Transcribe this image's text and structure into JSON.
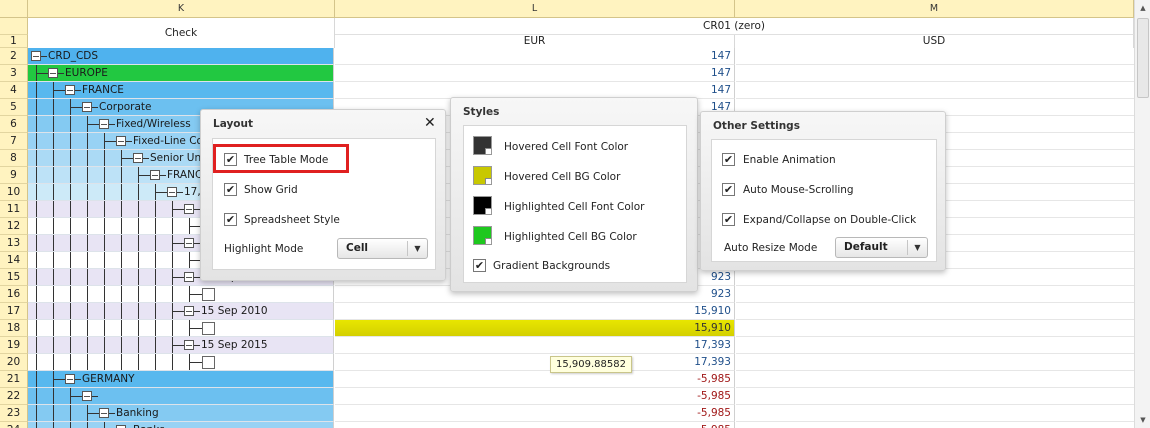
{
  "columns": {
    "k": "K",
    "l": "L",
    "m": "M",
    "check": "Check",
    "group": "CR01 (zero)",
    "eur": "EUR",
    "usd": "USD"
  },
  "rows": [
    {
      "n": "2",
      "label": "CRD_CDS",
      "val": "147"
    },
    {
      "n": "3",
      "label": "EUROPE",
      "val": "147"
    },
    {
      "n": "4",
      "label": "FRANCE",
      "val": "147"
    },
    {
      "n": "5",
      "label": "Corporate",
      "val": "147"
    },
    {
      "n": "6",
      "label": "Fixed/Wireless",
      "val": "147"
    },
    {
      "n": "7",
      "label": "Fixed-Line Com",
      "val": "147"
    },
    {
      "n": "8",
      "label": "Senior Unse",
      "val": "147"
    },
    {
      "n": "9",
      "label": "FRANCE",
      "val": "147"
    },
    {
      "n": "10",
      "label": "17,14",
      "val": "147"
    },
    {
      "n": "11",
      "label": "15",
      "val": ""
    },
    {
      "n": "12",
      "label": "",
      "val": ""
    },
    {
      "n": "13",
      "label": "17",
      "val": ""
    },
    {
      "n": "14",
      "label": "",
      "val": ""
    },
    {
      "n": "15",
      "label": "15 Sep 2008",
      "val": "923"
    },
    {
      "n": "16",
      "label": "",
      "val": "923"
    },
    {
      "n": "17",
      "label": "15 Sep 2010",
      "val": "15,910"
    },
    {
      "n": "18",
      "label": "",
      "val": "15,910"
    },
    {
      "n": "19",
      "label": "15 Sep 2015",
      "val": "17,393"
    },
    {
      "n": "20",
      "label": "",
      "val": "17,393"
    },
    {
      "n": "21",
      "label": "GERMANY",
      "val": "-5,985"
    },
    {
      "n": "22",
      "label": "",
      "val": "-5,985"
    },
    {
      "n": "23",
      "label": "Banking",
      "val": "-5,985"
    },
    {
      "n": "24",
      "label": "Banks",
      "val": "-5,985"
    }
  ],
  "header_row_nums": {
    "r1": "1"
  },
  "tooltip": "15,909.88582",
  "layout_panel": {
    "title": "Layout",
    "tree_table_mode": "Tree Table Mode",
    "show_grid": "Show Grid",
    "spreadsheet_style": "Spreadsheet Style",
    "highlight_mode_label": "Highlight Mode",
    "highlight_mode_value": "Cell"
  },
  "styles_panel": {
    "title": "Styles",
    "hovered_font": "Hovered Cell Font Color",
    "hovered_bg": "Hovered Cell BG Color",
    "highlighted_font": "Highlighted Cell Font Color",
    "highlighted_bg": "Highlighted Cell BG Color",
    "gradient": "Gradient Backgrounds"
  },
  "other_panel": {
    "title": "Other Settings",
    "enable_animation": "Enable Animation",
    "auto_mouse_scrolling": "Auto Mouse-Scrolling",
    "expand_collapse": "Expand/Collapse on Double-Click",
    "auto_resize_label": "Auto Resize Mode",
    "auto_resize_value": "Default"
  },
  "checkmark": "✔",
  "colors": {
    "hovered_font": "#333333",
    "hovered_bg": "#c8c800",
    "highlighted_font": "#000000",
    "highlighted_bg": "#1ec81e",
    "row_blue": "#5bb7ee",
    "row_green": "#22cc44",
    "highlight": "#dcdc00"
  }
}
